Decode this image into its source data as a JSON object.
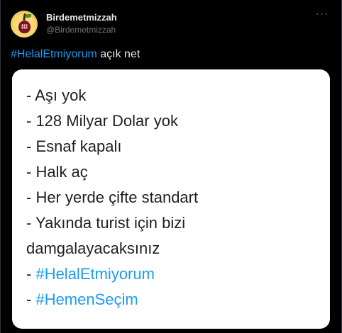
{
  "tweet": {
    "author": {
      "display_name": "Birdemetmizzah",
      "handle": "@Birdemetmizzah"
    },
    "more_icon": "ellipsis-icon",
    "text": {
      "hashtag": "#HelalEtmiyorum",
      "rest": " açık net"
    }
  },
  "image": {
    "lines": [
      {
        "text": "- Aşı yok",
        "style": "plain"
      },
      {
        "text": "- 128 Milyar Dolar yok",
        "style": "plain"
      },
      {
        "text": "- Esnaf kapalı",
        "style": "plain"
      },
      {
        "text": "- Halk aç",
        "style": "plain"
      },
      {
        "text": "- Her yerde çifte standart",
        "style": "plain"
      },
      {
        "text": "- Yakında turist için bizi",
        "style": "plain"
      },
      {
        "text": "damgalayacaksınız",
        "style": "plain"
      },
      {
        "prefix": "- ",
        "text": "#HelalEtmiyorum",
        "style": "hashtag"
      },
      {
        "prefix": "- ",
        "text": "#HemenSeçim",
        "style": "hashtag"
      }
    ]
  },
  "colors": {
    "background": "#000000",
    "text": "#e7e9ea",
    "muted": "#71767b",
    "link": "#1d9bf0"
  }
}
